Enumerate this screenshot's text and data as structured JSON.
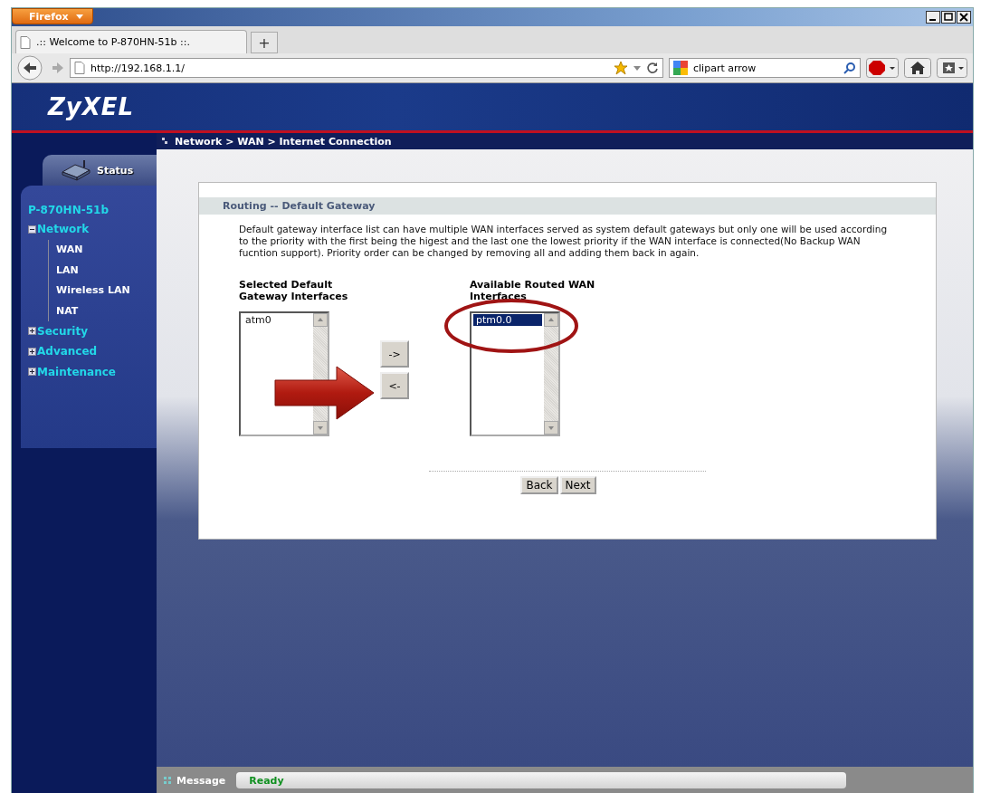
{
  "browser": {
    "menu_button": "Firefox",
    "tab_title": ".:: Welcome to P-870HN-51b ::.",
    "new_tab": "+",
    "url": "http://192.168.1.1/",
    "search_value": "clipart arrow"
  },
  "header": {
    "logo": "ZyXEL"
  },
  "breadcrumb": "Network > WAN > Internet Connection",
  "sidebar": {
    "status_tab": "Status",
    "device": "P-870HN-51b",
    "items": [
      {
        "label": "Network",
        "expanded": true,
        "children": [
          {
            "label": "WAN"
          },
          {
            "label": "LAN"
          },
          {
            "label": "Wireless LAN"
          },
          {
            "label": "NAT"
          }
        ]
      },
      {
        "label": "Security",
        "expanded": false
      },
      {
        "label": "Advanced",
        "expanded": false
      },
      {
        "label": "Maintenance",
        "expanded": false
      }
    ]
  },
  "panel": {
    "title": "Routing -- Default Gateway",
    "description": "Default gateway interface list can have multiple WAN interfaces served as system default gateways but only one will be used according to the priority with the first being the higest and the last one the lowest priority if the WAN interface is connected(No Backup WAN fucntion support). Priority order can be changed by removing all and adding them back in again.",
    "selected_list": {
      "heading": "Selected Default Gateway Interfaces",
      "items": [
        {
          "label": "atm0",
          "selected": false
        }
      ]
    },
    "available_list": {
      "heading": "Available Routed WAN Interfaces",
      "items": [
        {
          "label": "ptm0.0",
          "selected": true
        }
      ]
    },
    "move_buttons": [
      "->",
      "<-"
    ],
    "nav_buttons": [
      "Back",
      "Next"
    ]
  },
  "status_bar": {
    "label": "Message",
    "value": "Ready"
  }
}
